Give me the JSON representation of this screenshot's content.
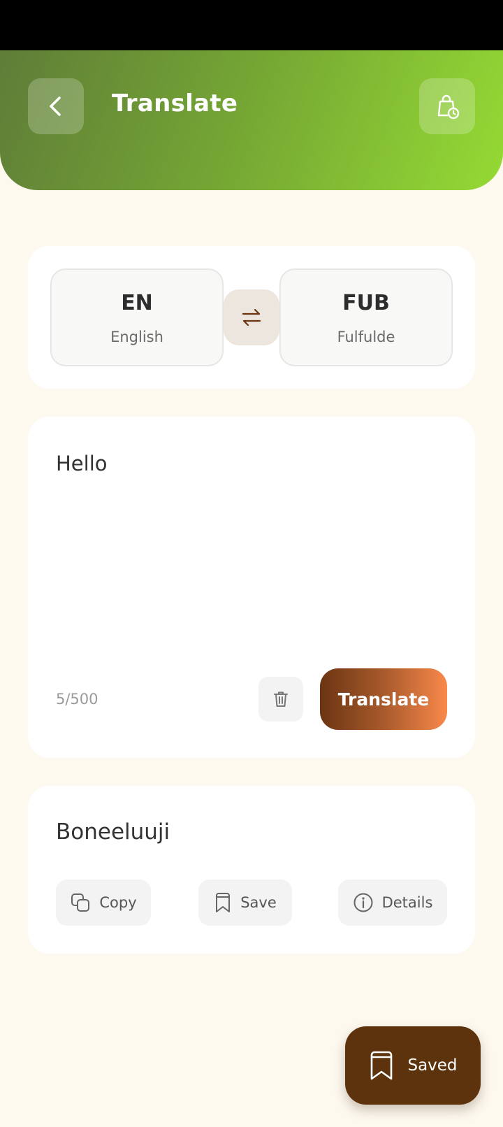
{
  "header": {
    "title": "Translate",
    "back_icon": "chevron-left-icon",
    "history_icon": "bag-clock-icon"
  },
  "languages": {
    "source": {
      "code": "EN",
      "name": "English"
    },
    "target": {
      "code": "FUB",
      "name": "Fulfulde"
    },
    "swap_icon": "swap-arrows-icon"
  },
  "input": {
    "text": "Hello",
    "char_count": "5/500",
    "clear_icon": "trash-icon",
    "translate_label": "Translate"
  },
  "output": {
    "text": "Boneeluuji",
    "actions": [
      {
        "label": "Copy",
        "icon": "copy-icon"
      },
      {
        "label": "Save",
        "icon": "bookmark-icon"
      },
      {
        "label": "Details",
        "icon": "info-icon"
      }
    ]
  },
  "fab": {
    "label": "Saved",
    "icon": "bookmark-icon"
  },
  "colors": {
    "background": "#fdf9ef",
    "header_gradient_start": "#5f7d38",
    "header_gradient_end": "#95da34",
    "accent_brown": "#5c330d",
    "translate_gradient_start": "#6b3512",
    "translate_gradient_end": "#f9884a"
  }
}
